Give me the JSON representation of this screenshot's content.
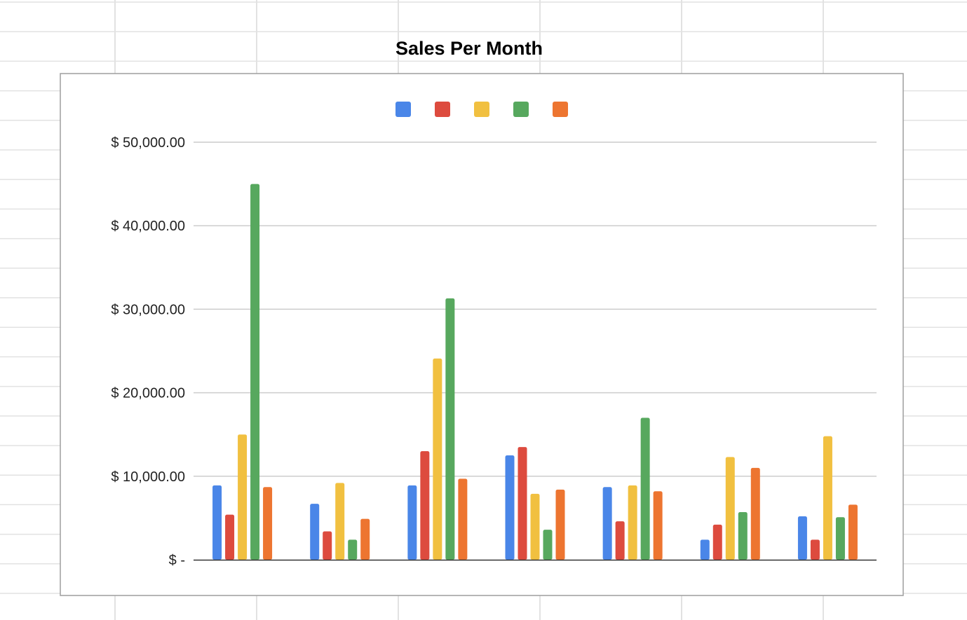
{
  "colors": {
    "cell_grid": "#e2e2e2",
    "chart_border": "#9e9e9e",
    "gridline": "#cccccc",
    "axis_line": "#333333"
  },
  "chart_data": {
    "type": "bar",
    "title": "Sales Per Month",
    "xlabel": "",
    "ylabel": "",
    "categories": [
      "",
      "",
      "",
      "",
      "",
      "",
      ""
    ],
    "ylim": [
      0,
      50000
    ],
    "y_ticks": [
      0,
      10000,
      20000,
      30000,
      40000,
      50000
    ],
    "y_tick_labels": [
      "$ -",
      "$ 10,000.00",
      "$ 20,000.00",
      "$ 30,000.00",
      "$ 40,000.00",
      "$ 50,000.00"
    ],
    "grid": true,
    "legend_position": "top",
    "series": [
      {
        "color": "#4a86e8",
        "values": [
          8900,
          6700,
          8900,
          12500,
          8700,
          2400,
          5200
        ]
      },
      {
        "color": "#dd4b3e",
        "values": [
          5400,
          3400,
          13000,
          13500,
          4600,
          4200,
          2400
        ]
      },
      {
        "color": "#f1c040",
        "values": [
          15000,
          9200,
          24100,
          7900,
          8900,
          12300,
          14800
        ]
      },
      {
        "color": "#57a85e",
        "values": [
          45000,
          2400,
          31300,
          3600,
          17000,
          5700,
          5100
        ]
      },
      {
        "color": "#ed7530",
        "values": [
          8700,
          4900,
          9700,
          8400,
          8200,
          11000,
          6600
        ]
      }
    ]
  }
}
